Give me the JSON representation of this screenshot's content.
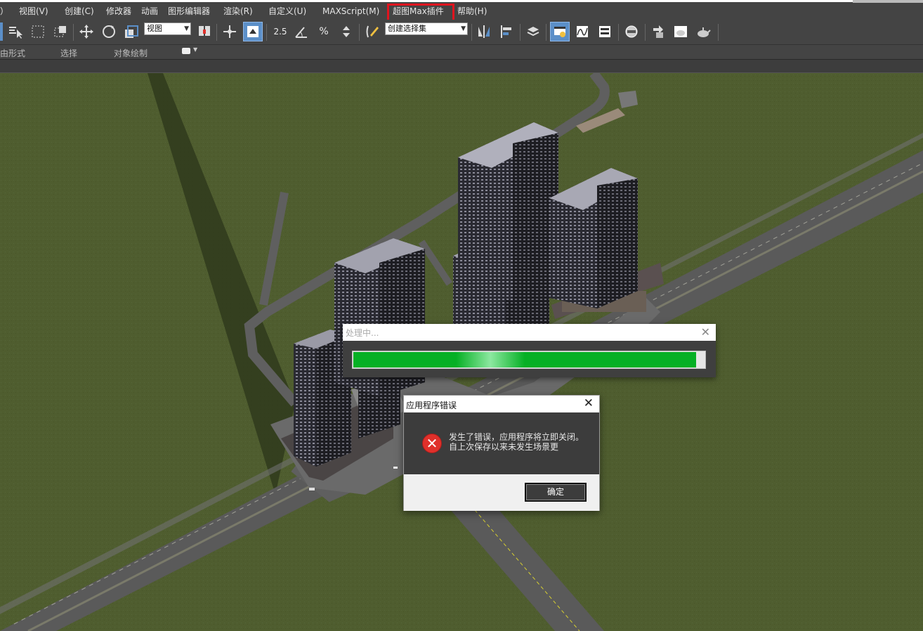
{
  "menubar": {
    "items": [
      "）",
      "视图(V)",
      "创建(C)",
      "修改器",
      "动画",
      "图形编辑器",
      "渲染(R)",
      "自定义(U)",
      "MAXScript(M)",
      "超图Max插件",
      "帮助(H)"
    ]
  },
  "toolbar": {
    "view_select": "视图",
    "snap_label": "2.5",
    "named_selection": "创建选择集"
  },
  "ribbon": {
    "tabs": [
      "由形式",
      "选择",
      "对象绘制"
    ]
  },
  "progress_dialog": {
    "title": "处理中...",
    "progress": 0.975
  },
  "error_dialog": {
    "title": "应用程序错误",
    "message": "发生了错误，应用程序将立即关闭。自上次保存以来未发生场景更",
    "ok_label": "确定"
  },
  "colors": {
    "ground": "#4d5c2e",
    "progress_green": "#06b025",
    "highlight_red": "#e0141e",
    "error_red": "#e0302b"
  }
}
